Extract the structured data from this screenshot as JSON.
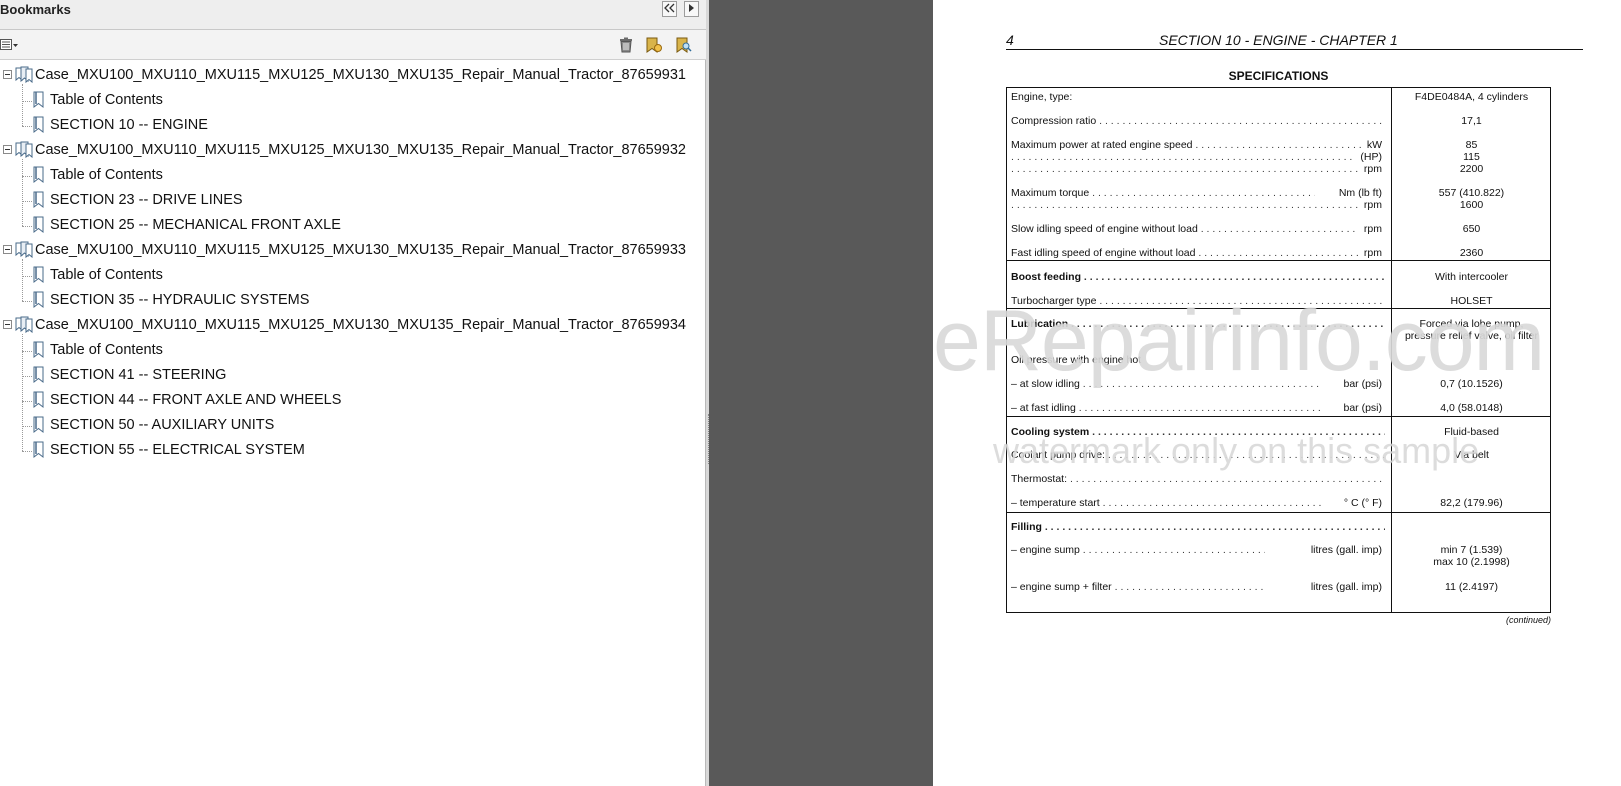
{
  "bookmarks_panel": {
    "title": "Bookmarks",
    "tree": [
      {
        "label": "Case_MXU100_MXU110_MXU115_MXU125_MXU130_MXU135_Repair_Manual_Tractor_87659931",
        "children": [
          "Table of Contents",
          "SECTION 10 -- ENGINE"
        ]
      },
      {
        "label": "Case_MXU100_MXU110_MXU115_MXU125_MXU130_MXU135_Repair_Manual_Tractor_87659932",
        "children": [
          "Table of Contents",
          "SECTION 23 -- DRIVE LINES",
          "SECTION 25 -- MECHANICAL FRONT AXLE"
        ]
      },
      {
        "label": "Case_MXU100_MXU110_MXU115_MXU125_MXU130_MXU135_Repair_Manual_Tractor_87659933",
        "children": [
          "Table of Contents",
          "SECTION 35 -- HYDRAULIC SYSTEMS"
        ]
      },
      {
        "label": "Case_MXU100_MXU110_MXU115_MXU125_MXU130_MXU135_Repair_Manual_Tractor_87659934",
        "children": [
          "Table of Contents",
          "SECTION 41 -- STEERING",
          "SECTION 44 -- FRONT AXLE AND WHEELS",
          "SECTION 50 -- AUXILIARY UNITS",
          "SECTION 55 -- ELECTRICAL SYSTEM"
        ]
      }
    ]
  },
  "document": {
    "page_number": "4",
    "running_header": "SECTION 10 - ENGINE - CHAPTER 1",
    "spec_title": "SPECIFICATIONS",
    "continued": "(continued)",
    "specs": [
      {
        "label": "Engine, type:",
        "unit": "",
        "value": "F4DE0484A, 4 cylinders"
      },
      {
        "label": "Compression ratio",
        "unit": "",
        "value": "17,1"
      },
      {
        "label": "Maximum power at rated engine speed",
        "unit": "kW",
        "value": "85"
      },
      {
        "label": "",
        "unit": "(HP)",
        "value": "115"
      },
      {
        "label": "",
        "unit": "rpm",
        "value": "2200"
      },
      {
        "label": "Maximum torque",
        "unit": "Nm (lb ft)",
        "value": "557 (410.822)"
      },
      {
        "label": "",
        "unit": "rpm",
        "value": "1600"
      },
      {
        "label": "Slow idling speed of engine without load",
        "unit": "rpm",
        "value": "650"
      },
      {
        "label": "Fast idling speed of engine without load",
        "unit": "rpm",
        "value": "2360"
      },
      {
        "label": "Boost feeding",
        "unit": "",
        "value": "With intercooler"
      },
      {
        "label": "Turbocharger type",
        "unit": "",
        "value": "HOLSET"
      },
      {
        "label": "Lubrication",
        "unit": "",
        "value": "Forced via lobe pump,"
      },
      {
        "label": "",
        "unit": "",
        "value": "pressure relief valve, oil filter"
      },
      {
        "label": "Oil pressure with engine hot",
        "unit": "",
        "value": ""
      },
      {
        "label": "–    at slow idling",
        "unit": "bar (psi)",
        "value": "0,7 (10.1526)"
      },
      {
        "label": "–    at fast idling",
        "unit": "bar (psi)",
        "value": "4,0 (58.0148)"
      },
      {
        "label": "Cooling system",
        "unit": "",
        "value": "Fluid-based"
      },
      {
        "label": "Coolant pump drive:",
        "unit": "",
        "value": "Via belt"
      },
      {
        "label": "Thermostat:",
        "unit": "",
        "value": ""
      },
      {
        "label": "–    temperature start",
        "unit": "° C (° F)",
        "value": "82,2 (179.96)"
      },
      {
        "label": "Filling",
        "unit": "",
        "value": ""
      },
      {
        "label": "–    engine sump",
        "unit": "litres (gall. imp)",
        "value": "min 7 (1.539)"
      },
      {
        "label": "",
        "unit": "",
        "value": "max 10 (2.1998)"
      },
      {
        "label": "–    engine sump + filter",
        "unit": "litres (gall. imp)",
        "value": "11 (2.4197)"
      }
    ]
  },
  "watermark": {
    "line1": "eRepairinfo.com",
    "line2": "watermark only on this sample"
  },
  "colors": {
    "viewer_background": "#595959",
    "panel_background": "#ffffff",
    "bookmark_icon": "#4a6b8a"
  }
}
